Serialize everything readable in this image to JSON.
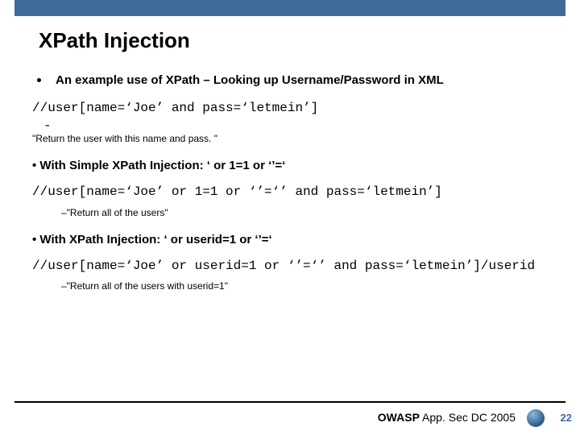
{
  "slide": {
    "title": "XPath Injection",
    "bullet1": "An example use of XPath – Looking up Username/Password in XML",
    "code1": "//user[name=‘Joe’ and pass=‘letmein’]",
    "dash": "-",
    "desc1": "\"Return the user with this name and pass. \"",
    "bullet2": "• With Simple XPath Injection: ‘ or 1=1 or ‘’=‘",
    "code2": "//user[name=‘Joe’ or 1=1 or ‘’=‘’ and pass=‘letmein’]",
    "desc2": "–\"Return all of the users\"",
    "bullet3": "• With XPath Injection: ‘ or userid=1 or ‘’=‘",
    "code3": "//user[name=‘Joe’ or userid=1 or ‘’=‘’ and pass=‘letmein’]/userid",
    "desc3": "–\"Return all of the users with userid=1\""
  },
  "footer": {
    "org": "OWASP",
    "event": " App. Sec DC 2005",
    "page": "22"
  }
}
